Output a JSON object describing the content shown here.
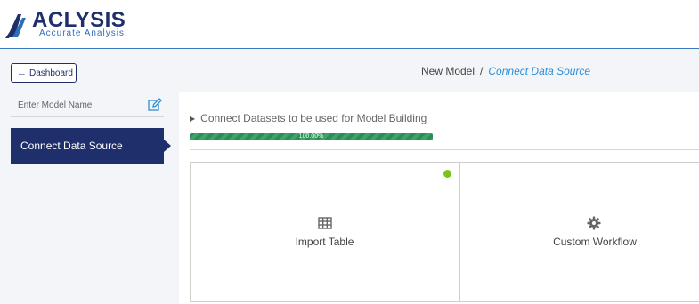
{
  "brand": {
    "name": "ACLYSIS",
    "tagline": "Accurate Analysis",
    "primary_color": "#1e2f6b",
    "accent_color": "#2c6fb7"
  },
  "nav": {
    "dashboard_label": "Dashboard",
    "dashboard_icon": "arrow-left-icon"
  },
  "breadcrumb": {
    "parent": "New Model",
    "separator": "/",
    "current": "Connect Data Source"
  },
  "sidebar": {
    "model_name_placeholder": "Enter Model Name",
    "model_name_value": "",
    "edit_icon": "edit-icon",
    "steps": [
      {
        "label": "Connect Data Source",
        "active": true
      }
    ]
  },
  "main": {
    "section_title": "Connect Datasets to be used for Model Building",
    "progress_label": "100.00%",
    "progress_value": 1.0,
    "progress_color": "#2e8b57",
    "options": [
      {
        "label": "Import Table",
        "icon": "table-grid-icon",
        "selected": true,
        "status_color": "#7cc41a"
      },
      {
        "label": "Custom Workflow",
        "icon": "gear-icon",
        "selected": false
      }
    ]
  }
}
